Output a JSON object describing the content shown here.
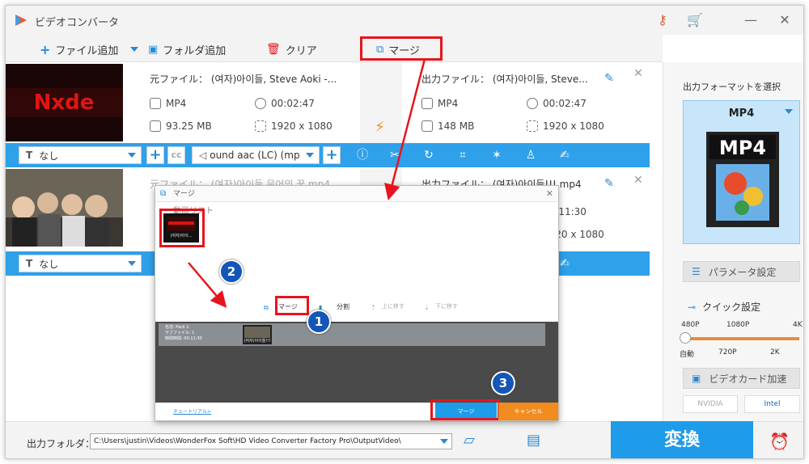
{
  "app": {
    "title": "ビデオコンバータ"
  },
  "toolbar": {
    "add_file": "ファイル追加",
    "add_folder": "フォルダ追加",
    "clear": "クリア",
    "merge": "マージ"
  },
  "files": [
    {
      "source_label": "元ファイル：",
      "source_name": "(여자)아이들, Steve Aoki -...",
      "src_format": "MP4",
      "src_duration": "00:02:47",
      "src_size": "93.25 MB",
      "src_resolution": "1920 x 1080",
      "output_label": "出力ファイル：",
      "output_name": "(여자)아이들, Steve...",
      "out_format": "MP4",
      "out_duration": "00:02:47",
      "out_size": "148 MB",
      "out_resolution": "1920 x 1080",
      "subtitle": "なし",
      "audio": "ound aac (LC) (mp"
    },
    {
      "source_label": "元ファイル：",
      "source_name": "(여자)아이들 문어의 꿈.mp4",
      "output_label": "出力ファイル：",
      "output_name": "(여자)아이들!!!.mp4",
      "out_duration": "00:11:30",
      "out_resolution": "1920 x 1080",
      "subtitle": "なし"
    }
  ],
  "right_panel": {
    "select_format": "出力フォーマットを選択",
    "format": "MP4",
    "params": "パラメータ設定",
    "quick": "クイック設定",
    "quality_top": [
      "480P",
      "1080P",
      "4K"
    ],
    "quality_bottom": [
      "自動",
      "720P",
      "2K"
    ],
    "gpu": "ビデオカード加速",
    "vendor1": "NVIDIA",
    "vendor2": "Intel"
  },
  "bottom": {
    "folder_label": "出力フォルダ：",
    "folder_path": "C:\\Users\\justin\\Videos\\WonderFox Soft\\HD Video Converter Factory Pro\\OutputVideo\\",
    "convert": "変換"
  },
  "dialog": {
    "title": "マージ",
    "list_label": "動画リスト",
    "clip_caption": "(여자)아이...",
    "merge_btn": "マージ",
    "split_btn": "分割",
    "up_btn": "上に移す",
    "down_btn": "下に移す",
    "pack_name": "名前: Pack 1",
    "pack_count": "サブファイル: 1",
    "pack_duration": "時間時間: 00:11:30",
    "pack_clip_caption": "(여자)아이들!!!",
    "tutorial": "チュートリアル>",
    "confirm": "マージ",
    "cancel": "キャンセル"
  },
  "steps": [
    "1",
    "2",
    "3"
  ],
  "colors": {
    "accent": "#2fa0ea",
    "highlight": "#e8141c",
    "badge": "#1356b8",
    "cancel": "#f28c1f"
  }
}
